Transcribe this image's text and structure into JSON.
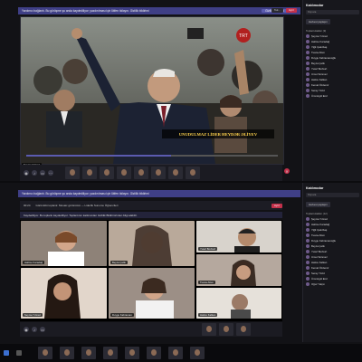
{
  "top": {
    "notice": "Yardımcı bağlantı. Bu görüşme şu anda kaydediliyor; yazdırılması için lütfen tıklayın. Gizlilik bildirimi",
    "notice_button": "Gizlilik bildirimi",
    "time": "Tek…",
    "leave_label": "Ayrıl",
    "video_badge": "TRT",
    "video_caption": "UNUDULMAZ LİDER HEYDƏR ƏLİYEV",
    "presenter_label": "Şeyma Yılmaz"
  },
  "top_sidebar": {
    "title": "Katılımcılar",
    "search_placeholder": "Kişi ara",
    "button": "Herkesi paylaşın",
    "section": "Toplantıdakiler (9)",
    "people": [
      "Şeyma Yılmaz",
      "Halime Karadağ",
      "Yiğit Çakırbaş",
      "Tuana Altun",
      "Duygu Kahramanoğlu",
      "Beyza Çelik",
      "Yusuf Bozkurt",
      "Umut Sönmez",
      "Hatice Kalkan",
      "Kemal Özdemir",
      "Seray Yıldız",
      "Ümmügül Erol"
    ]
  },
  "bottom": {
    "notice": "Yardımcı bağlantı. Bu görüşme şu anda kaydediliyor; yazdırılması için lütfen tıklayın. Gizlilik bildirimi",
    "meeting_title": "Görüntülü toplantı: Mosaic görünümü — Liderlik Sunumu Öğrencileri",
    "header_time": "00:24",
    "note": "Kaydediliyor. Bu toplantı kaydediliyor. Toplantının katılımcıları Gizlilik Bildirimi'nden bilgi alabilir.",
    "leave_label": "Ayrıl",
    "tiles": [
      {
        "label": "Halime Karadağ"
      },
      {
        "label": "Beyza Çelik"
      },
      {
        "label": "Yusuf Bozkurt"
      },
      {
        "label": "Şeyma Yılmaz"
      },
      {
        "label": "Duygu Kahraman"
      },
      {
        "label": "Tuana Altun"
      },
      {
        "label": "Hatice Kalkan"
      },
      {
        "label": "Yiğit Çakırbaş"
      },
      {
        "label": "Seray Yıldız"
      }
    ]
  },
  "bottom_sidebar": {
    "title": "Katılımcılar",
    "search_placeholder": "Kişi ara",
    "button": "Herkesi paylaşın",
    "section": "Toplantıdakiler (12)",
    "people": [
      "Şeyma Yılmaz",
      "Halime Karadağ",
      "Yiğit Çakırbaş",
      "Tuana Altun",
      "Duygu Kahramanoğlu",
      "Beyza Çelik",
      "Yusuf Bozkurt",
      "Umut Sönmez",
      "Hatice Kalkan",
      "Kemal Özdemir",
      "Seray Yıldız",
      "Ümmügül Erol",
      "Oğuz Yalçın"
    ]
  },
  "colors": {
    "accent": "#5b5bb0",
    "leave": "#c4314b",
    "caption": "#ffd34d"
  }
}
